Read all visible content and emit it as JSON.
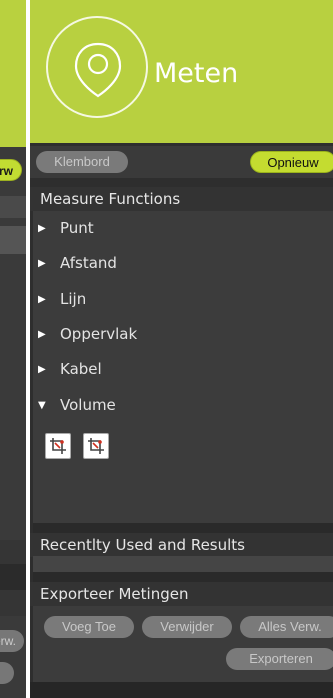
{
  "left_panel": {
    "button_green_label": "rw",
    "button_gray_label": "Verw."
  },
  "header": {
    "app_title": "Meten",
    "icon": "location-pin-icon",
    "accent_color": "#b8d040"
  },
  "toolbar": {
    "klembord_label": "Klembord",
    "opnieuw_label": "Opnieuw"
  },
  "measure": {
    "title": "Measure Functions",
    "items": [
      {
        "label": "Punt",
        "expanded": false
      },
      {
        "label": "Afstand",
        "expanded": false
      },
      {
        "label": "Lijn",
        "expanded": false
      },
      {
        "label": "Oppervlak",
        "expanded": false
      },
      {
        "label": "Kabel",
        "expanded": false
      },
      {
        "label": "Volume",
        "expanded": true
      }
    ],
    "volume_tools": [
      "crop-tool-icon",
      "crop-tool-icon"
    ]
  },
  "recent": {
    "title": "Recentlty Used and Results"
  },
  "export": {
    "title": "Exporteer Metingen",
    "buttons": {
      "voeg_toe": "Voeg Toe",
      "verwijder": "Verwijder",
      "alles_verw": "Alles Verw.",
      "exporteren": "Exporteren"
    }
  }
}
